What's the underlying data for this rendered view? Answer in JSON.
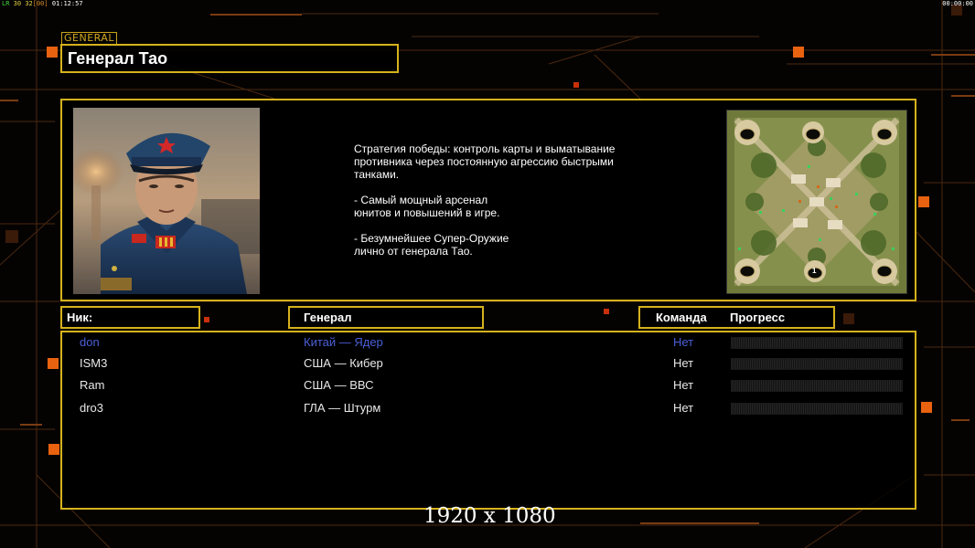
{
  "overlay": {
    "fps_prefix": "LR",
    "fps_a": "30",
    "fps_b": "32",
    "fps_c": "[00]",
    "fps_time": "01:12:57",
    "right_clock": "00:00:00"
  },
  "general": {
    "tag": "GENERAL",
    "title": "Генерал Тао",
    "description": "Стратегия победы: контроль карты и выматывание\n противника через постоянную агрессию быстрыми\n танками.\n\n- Самый мощный арсенал\nюнитов и повышений в игре.\n\n- Безумнейшее Супер-Оружие\nлично от генерала Тао.",
    "portrait_icon": "general-portrait",
    "minimap_icon": "map-preview",
    "minimap_marker": "1"
  },
  "headers": {
    "nick": "Ник:",
    "general": "Генерал",
    "team": "Команда",
    "progress": "Прогресс"
  },
  "players": [
    {
      "nick": "don",
      "general": "Китай — Ядер",
      "team": "Нет"
    },
    {
      "nick": "ISM3",
      "general": "США — Кибер",
      "team": "Нет"
    },
    {
      "nick": "Ram",
      "general": "США — ВВС",
      "team": "Нет"
    },
    {
      "nick": "dro3",
      "general": "ГЛА — Штурм",
      "team": "Нет"
    }
  ],
  "resolution_label": "1920 x 1080",
  "colors": {
    "accent": "#d6b21c",
    "local_player": "#4a5fd8",
    "background": "#050302",
    "bg_lines": "#5a2e10",
    "bg_squares": "#e06010"
  }
}
